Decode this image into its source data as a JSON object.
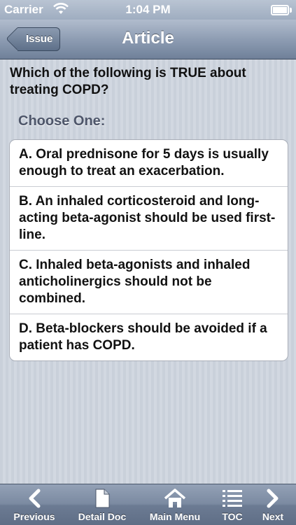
{
  "status_bar": {
    "carrier": "Carrier",
    "time": "1:04 PM"
  },
  "nav": {
    "back_label": "Issue",
    "title": "Article"
  },
  "question": {
    "text": "Which of the following is TRUE about treating COPD?",
    "prompt": "Choose One:",
    "answers": [
      "A.  Oral prednisone for 5 days is usually enough to treat an exacerbation.",
      "B.  An inhaled corticosteroid and long-acting beta-agonist should be used first-line.",
      "C.  Inhaled beta-agonists and inhaled anticholinergics should not be combined.",
      "D.  Beta-blockers should be avoided if a patient has COPD."
    ]
  },
  "toolbar": {
    "previous": "Previous",
    "detail_doc": "Detail Doc",
    "main_menu": "Main Menu",
    "toc": "TOC",
    "next": "Next"
  },
  "icons": [
    "wifi-icon",
    "battery-icon",
    "chevron-left-icon",
    "document-icon",
    "home-icon",
    "list-icon",
    "chevron-right-icon"
  ]
}
